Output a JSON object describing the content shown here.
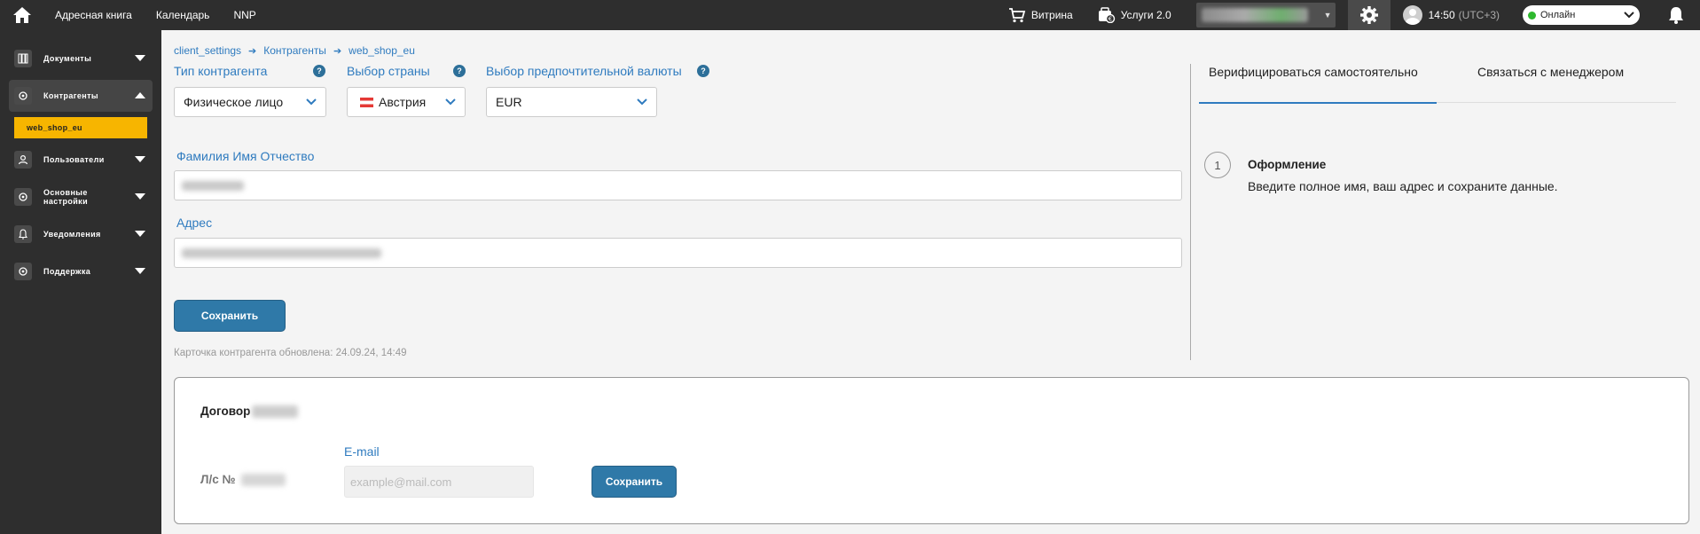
{
  "topbar": {
    "nav": [
      "Адресная книга",
      "Календарь",
      "NNP"
    ],
    "vitrina": "Витрина",
    "services": "Услуги 2.0",
    "time": "14:50",
    "utc": "(UTC+3)",
    "status": "Онлайн"
  },
  "sidebar": {
    "items": [
      {
        "label": "Документы",
        "icon": "documents-icon"
      },
      {
        "label": "Контрагенты",
        "icon": "gear-icon"
      },
      {
        "label": "Пользователи",
        "icon": "user-icon"
      },
      {
        "label": "Основные настройки",
        "icon": "gear-icon"
      },
      {
        "label": "Уведомления",
        "icon": "bell-icon"
      },
      {
        "label": "Поддержка",
        "icon": "gear-icon"
      }
    ],
    "subitem": "web_shop_eu"
  },
  "breadcrumbs": [
    "client_settings",
    "Контрагенты",
    "web_shop_eu"
  ],
  "form": {
    "type_label": "Тип контрагента",
    "type_value": "Физическое лицо",
    "country_label": "Выбор страны",
    "country_value": "Австрия",
    "currency_label": "Выбор предпочтительной валюты",
    "currency_value": "EUR",
    "name_label": "Фамилия Имя Отчество",
    "address_label": "Адрес",
    "save_label": "Сохранить",
    "updated_text": "Карточка контрагента обновлена: 24.09.24, 14:49"
  },
  "verify": {
    "tabs": [
      "Верифицироваться самостоятельно",
      "Связаться с менеджером"
    ],
    "step_number": "1",
    "step_title": "Оформление",
    "step_desc": "Введите полное имя, ваш адрес и сохраните данные."
  },
  "contract": {
    "title": "Договор",
    "account_label": "Л/с №",
    "email_label": "E-mail",
    "email_placeholder": "example@mail.com",
    "save_label": "Сохранить"
  },
  "colors": {
    "accent": "#2f7bbf",
    "active_sub": "#f7b500",
    "button": "#2f79a8"
  }
}
